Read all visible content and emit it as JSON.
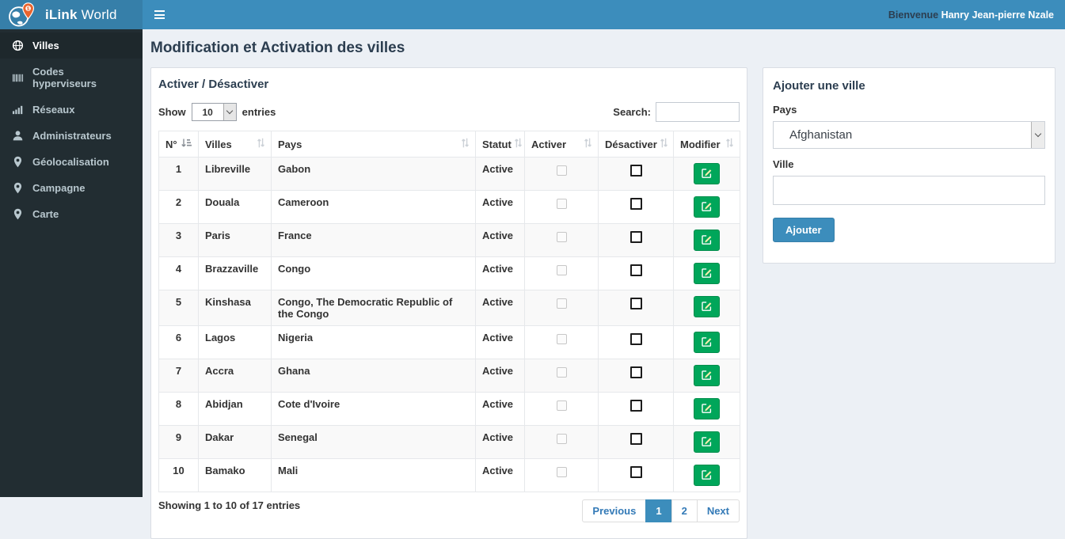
{
  "header": {
    "brand_bold": "iLink",
    "brand_regular": " World",
    "welcome_prefix": "Bienvenue ",
    "welcome_name": "Hanry Jean-pierre Nzale"
  },
  "sidebar": {
    "items": [
      {
        "label": "Villes",
        "icon": "globe-icon",
        "active": true
      },
      {
        "label": "Codes hyperviseurs",
        "icon": "barcode-icon",
        "active": false
      },
      {
        "label": "Réseaux",
        "icon": "signal-icon",
        "active": false
      },
      {
        "label": "Administrateurs",
        "icon": "user-icon",
        "active": false
      },
      {
        "label": "Géolocalisation",
        "icon": "map-marker-icon",
        "active": false
      },
      {
        "label": "Campagne",
        "icon": "map-marker-icon",
        "active": false
      },
      {
        "label": "Carte",
        "icon": "map-marker-icon",
        "active": false
      }
    ]
  },
  "page": {
    "title": "Modification et Activation des villes"
  },
  "table_panel": {
    "title": "Activer / Désactiver",
    "show_label": "Show",
    "page_length": "10",
    "entries_label": "entries",
    "search_label": "Search:",
    "search_value": "",
    "columns": [
      "N°",
      "Villes",
      "Pays",
      "Statut",
      "Activer",
      "Désactiver",
      "Modifier"
    ],
    "rows": [
      {
        "num": "1",
        "ville": "Libreville",
        "pays": "Gabon",
        "statut": "Active"
      },
      {
        "num": "2",
        "ville": "Douala",
        "pays": "Cameroon",
        "statut": "Active"
      },
      {
        "num": "3",
        "ville": "Paris",
        "pays": "France",
        "statut": "Active"
      },
      {
        "num": "4",
        "ville": "Brazzaville",
        "pays": "Congo",
        "statut": "Active"
      },
      {
        "num": "5",
        "ville": "Kinshasa",
        "pays": "Congo, The Democratic Republic of the Congo",
        "statut": "Active"
      },
      {
        "num": "6",
        "ville": "Lagos",
        "pays": "Nigeria",
        "statut": "Active"
      },
      {
        "num": "7",
        "ville": "Accra",
        "pays": "Ghana",
        "statut": "Active"
      },
      {
        "num": "8",
        "ville": "Abidjan",
        "pays": "Cote d'Ivoire",
        "statut": "Active"
      },
      {
        "num": "9",
        "ville": "Dakar",
        "pays": "Senegal",
        "statut": "Active"
      },
      {
        "num": "10",
        "ville": "Bamako",
        "pays": "Mali",
        "statut": "Active"
      }
    ],
    "info": "Showing 1 to 10 of 17 entries",
    "pagination": {
      "previous_label": "Previous",
      "pages": [
        "1",
        "2"
      ],
      "active_page": "1",
      "next_label": "Next"
    }
  },
  "add_panel": {
    "title": "Ajouter une ville",
    "pays_label": "Pays",
    "pays_value": "Afghanistan",
    "ville_label": "Ville",
    "ville_value": "",
    "submit_label": "Ajouter"
  },
  "colors": {
    "navbar": "#3c8dbc",
    "logo_bg": "#367fa9",
    "sidebar_bg": "#222d32",
    "sidebar_active_bg": "#1e282c",
    "content_bg": "#ecf0f5",
    "success_green": "#00a65a",
    "primary_blue": "#3c8dbc",
    "pin_orange": "#e9642e"
  }
}
